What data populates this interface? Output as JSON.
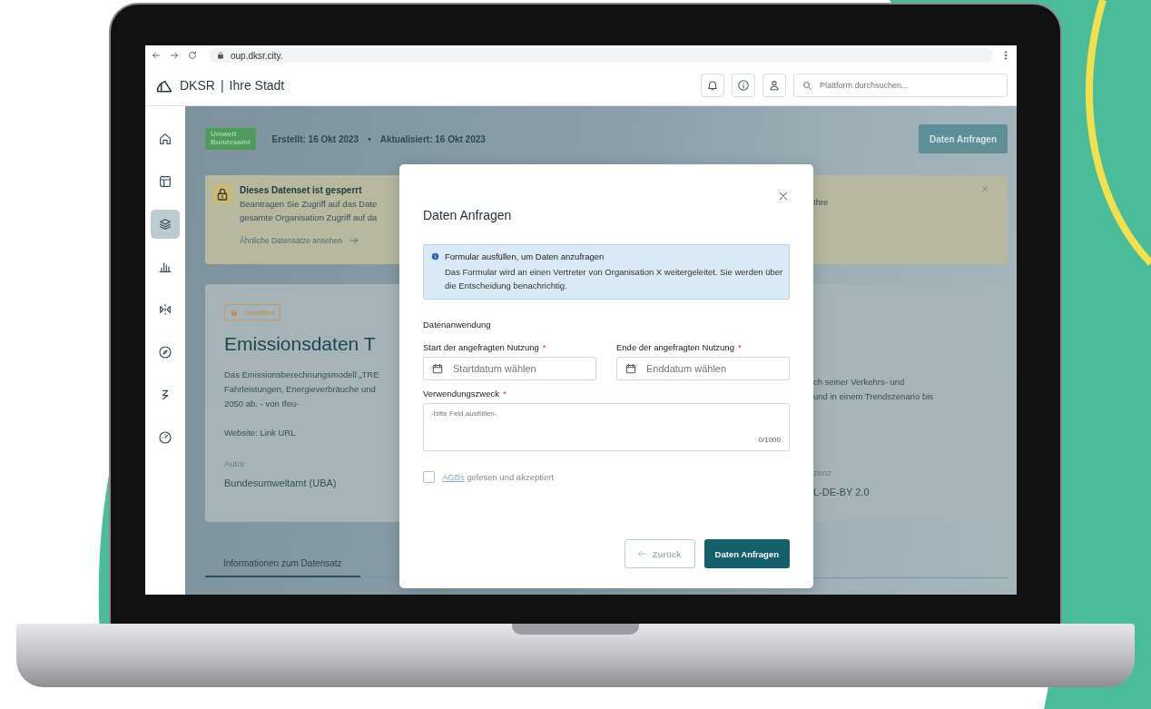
{
  "browser": {
    "url": "oup.dksr.city."
  },
  "app_header": {
    "brand": "DKSR",
    "separator": "|",
    "city": "Ihre Stadt",
    "search": {
      "placeholder": "Plattform durchsuchen..."
    }
  },
  "sidebar": {
    "items": [
      {
        "selected": false
      },
      {
        "selected": false
      },
      {
        "selected": true
      },
      {
        "selected": false
      },
      {
        "selected": false
      },
      {
        "selected": false
      },
      {
        "selected": false
      },
      {
        "selected": false
      }
    ]
  },
  "dataset": {
    "publisher_logo": [
      "Umwelt",
      "Bundesamt"
    ],
    "created": "Erstellt: 16 Okt 2023",
    "separator": "•",
    "updated": "Aktualisiert: 16 Okt 2023",
    "request_button": "Daten Anfragen"
  },
  "lock_notice": {
    "title": "Dieses Datenset ist gesperrt",
    "text_left": [
      "Beantragen Sie Zugriff auf das Date",
      "gesamte Organisation Zugriff auf da"
    ],
    "text_right": [
      "Ihre"
    ],
    "link": "Ähnliche Datensätze ansehen"
  },
  "card": {
    "badge": "Classified",
    "title": "Emissionsdaten T",
    "description_left": [
      "Das Emissionsberechnungsmodell „TRE",
      "Fahrleistungen, Energieverbräuche und",
      "2050 ab.  - von Ifeu-"
    ],
    "description_right": [
      "ch seiner Verkehrs- und",
      "und in einem Trendszenario bis"
    ],
    "website": "Website: Link URL",
    "author_label": "Autor",
    "author": "Bundesumweltamt (UBA)",
    "license_label": "zenz",
    "license": "L-DE-BY 2.0"
  },
  "tabs": [
    {
      "label": "Informationen zum Datensatz",
      "selected": true
    }
  ],
  "modal": {
    "title": "Daten Anfragen",
    "info": {
      "title": "Formular ausfüllen, um Daten anzufragen",
      "text": "Das Formular wird an einen Vertreter von Organisation X weitergeleitet. Sie werden über die Entscheidung benachrichtig."
    },
    "section": "Datenanwendung",
    "fields": [
      {
        "kind": "date",
        "label": "Start der angefragten Nutzung",
        "required_mark": "*",
        "placeholder": "Startdatum wählen"
      },
      {
        "kind": "date",
        "label": "Ende der angefragten Nutzung",
        "required_mark": "*",
        "placeholder": "Enddatum wählen"
      },
      {
        "kind": "textarea",
        "label": "Verwendungszweck",
        "required_mark": "*",
        "placeholder": "-bitte Feld ausfüllen-",
        "counter": "0/1000"
      }
    ],
    "terms": {
      "checked": false,
      "link": "AGBs",
      "text": " gelesen und akzeptiert"
    },
    "buttons": [
      {
        "kind": "back",
        "label": "Zurück",
        "disabled": true
      },
      {
        "kind": "primary",
        "label": "Daten Anfragen",
        "disabled": false
      }
    ]
  }
}
